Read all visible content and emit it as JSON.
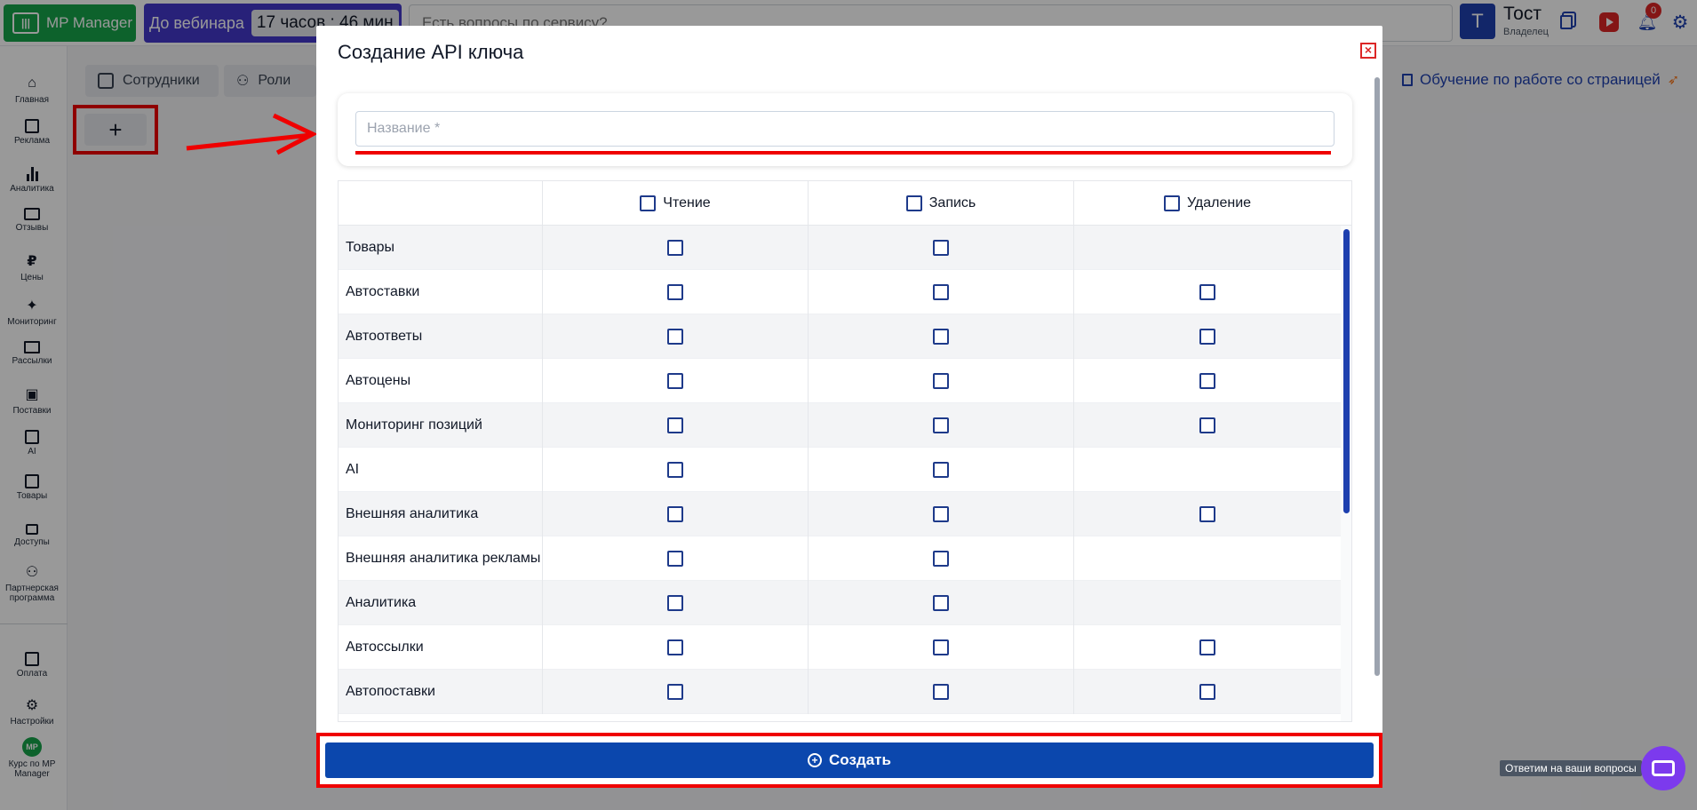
{
  "topbar": {
    "logo_text": "MP Manager",
    "webinar_label": "До вебинара",
    "webinar_timer": "17 часов : 46 мин",
    "search_placeholder": "Есть вопросы по сервису?",
    "avatar_letter": "Т",
    "user_name": "Тост",
    "user_role": "Владелец",
    "notifications_count": "0"
  },
  "sidebar": {
    "items": [
      {
        "label": "Главная",
        "icon": "home-icon"
      },
      {
        "label": "Реклама",
        "icon": "ads-icon"
      },
      {
        "label": "Аналитика",
        "icon": "analytics-icon"
      },
      {
        "label": "Отзывы",
        "icon": "reviews-icon"
      },
      {
        "label": "Цены",
        "icon": "ruble-icon"
      },
      {
        "label": "Мониторинг",
        "icon": "monitoring-icon"
      },
      {
        "label": "Рассылки",
        "icon": "mail-icon"
      },
      {
        "label": "Поставки",
        "icon": "truck-icon"
      },
      {
        "label": "AI",
        "icon": "robot-icon"
      },
      {
        "label": "Товары",
        "icon": "archive-icon"
      },
      {
        "label": "Доступы",
        "icon": "lock-icon"
      },
      {
        "label": "Партнерская программа",
        "icon": "partners-icon"
      },
      {
        "label": "Оплата",
        "icon": "wallet-icon"
      },
      {
        "label": "Настройки",
        "icon": "gear-icon"
      },
      {
        "label": "Курс по MP Manager",
        "icon": "course-icon"
      }
    ]
  },
  "page": {
    "tab_employees": "Сотрудники",
    "tab_roles": "Роли",
    "add_label": "+",
    "help_link": "Обучение по работе со страницей",
    "chat_tip": "Ответим на ваши вопросы"
  },
  "modal": {
    "title": "Создание API ключа",
    "close": "×",
    "name_placeholder": "Название *",
    "columns": [
      "Чтение",
      "Запись",
      "Удаление"
    ],
    "rows": [
      {
        "name": "Товары",
        "read": true,
        "write": true,
        "delete": false
      },
      {
        "name": "Автоставки",
        "read": true,
        "write": true,
        "delete": true
      },
      {
        "name": "Автоответы",
        "read": true,
        "write": true,
        "delete": true
      },
      {
        "name": "Автоцены",
        "read": true,
        "write": true,
        "delete": true
      },
      {
        "name": "Мониторинг позиций",
        "read": true,
        "write": true,
        "delete": true
      },
      {
        "name": "AI",
        "read": true,
        "write": true,
        "delete": false
      },
      {
        "name": "Внешняя аналитика",
        "read": true,
        "write": true,
        "delete": true
      },
      {
        "name": "Внешняя аналитика рекламы",
        "read": true,
        "write": true,
        "delete": false
      },
      {
        "name": "Аналитика",
        "read": true,
        "write": true,
        "delete": false
      },
      {
        "name": "Автоссылки",
        "read": true,
        "write": true,
        "delete": true
      },
      {
        "name": "Автопоставки",
        "read": true,
        "write": true,
        "delete": true
      }
    ],
    "create_label": "Создать"
  },
  "colors": {
    "accent": "#0b47ad",
    "highlight": "#ef0000",
    "logo_green": "#16a34a",
    "webinar_purple": "#4338ca"
  }
}
